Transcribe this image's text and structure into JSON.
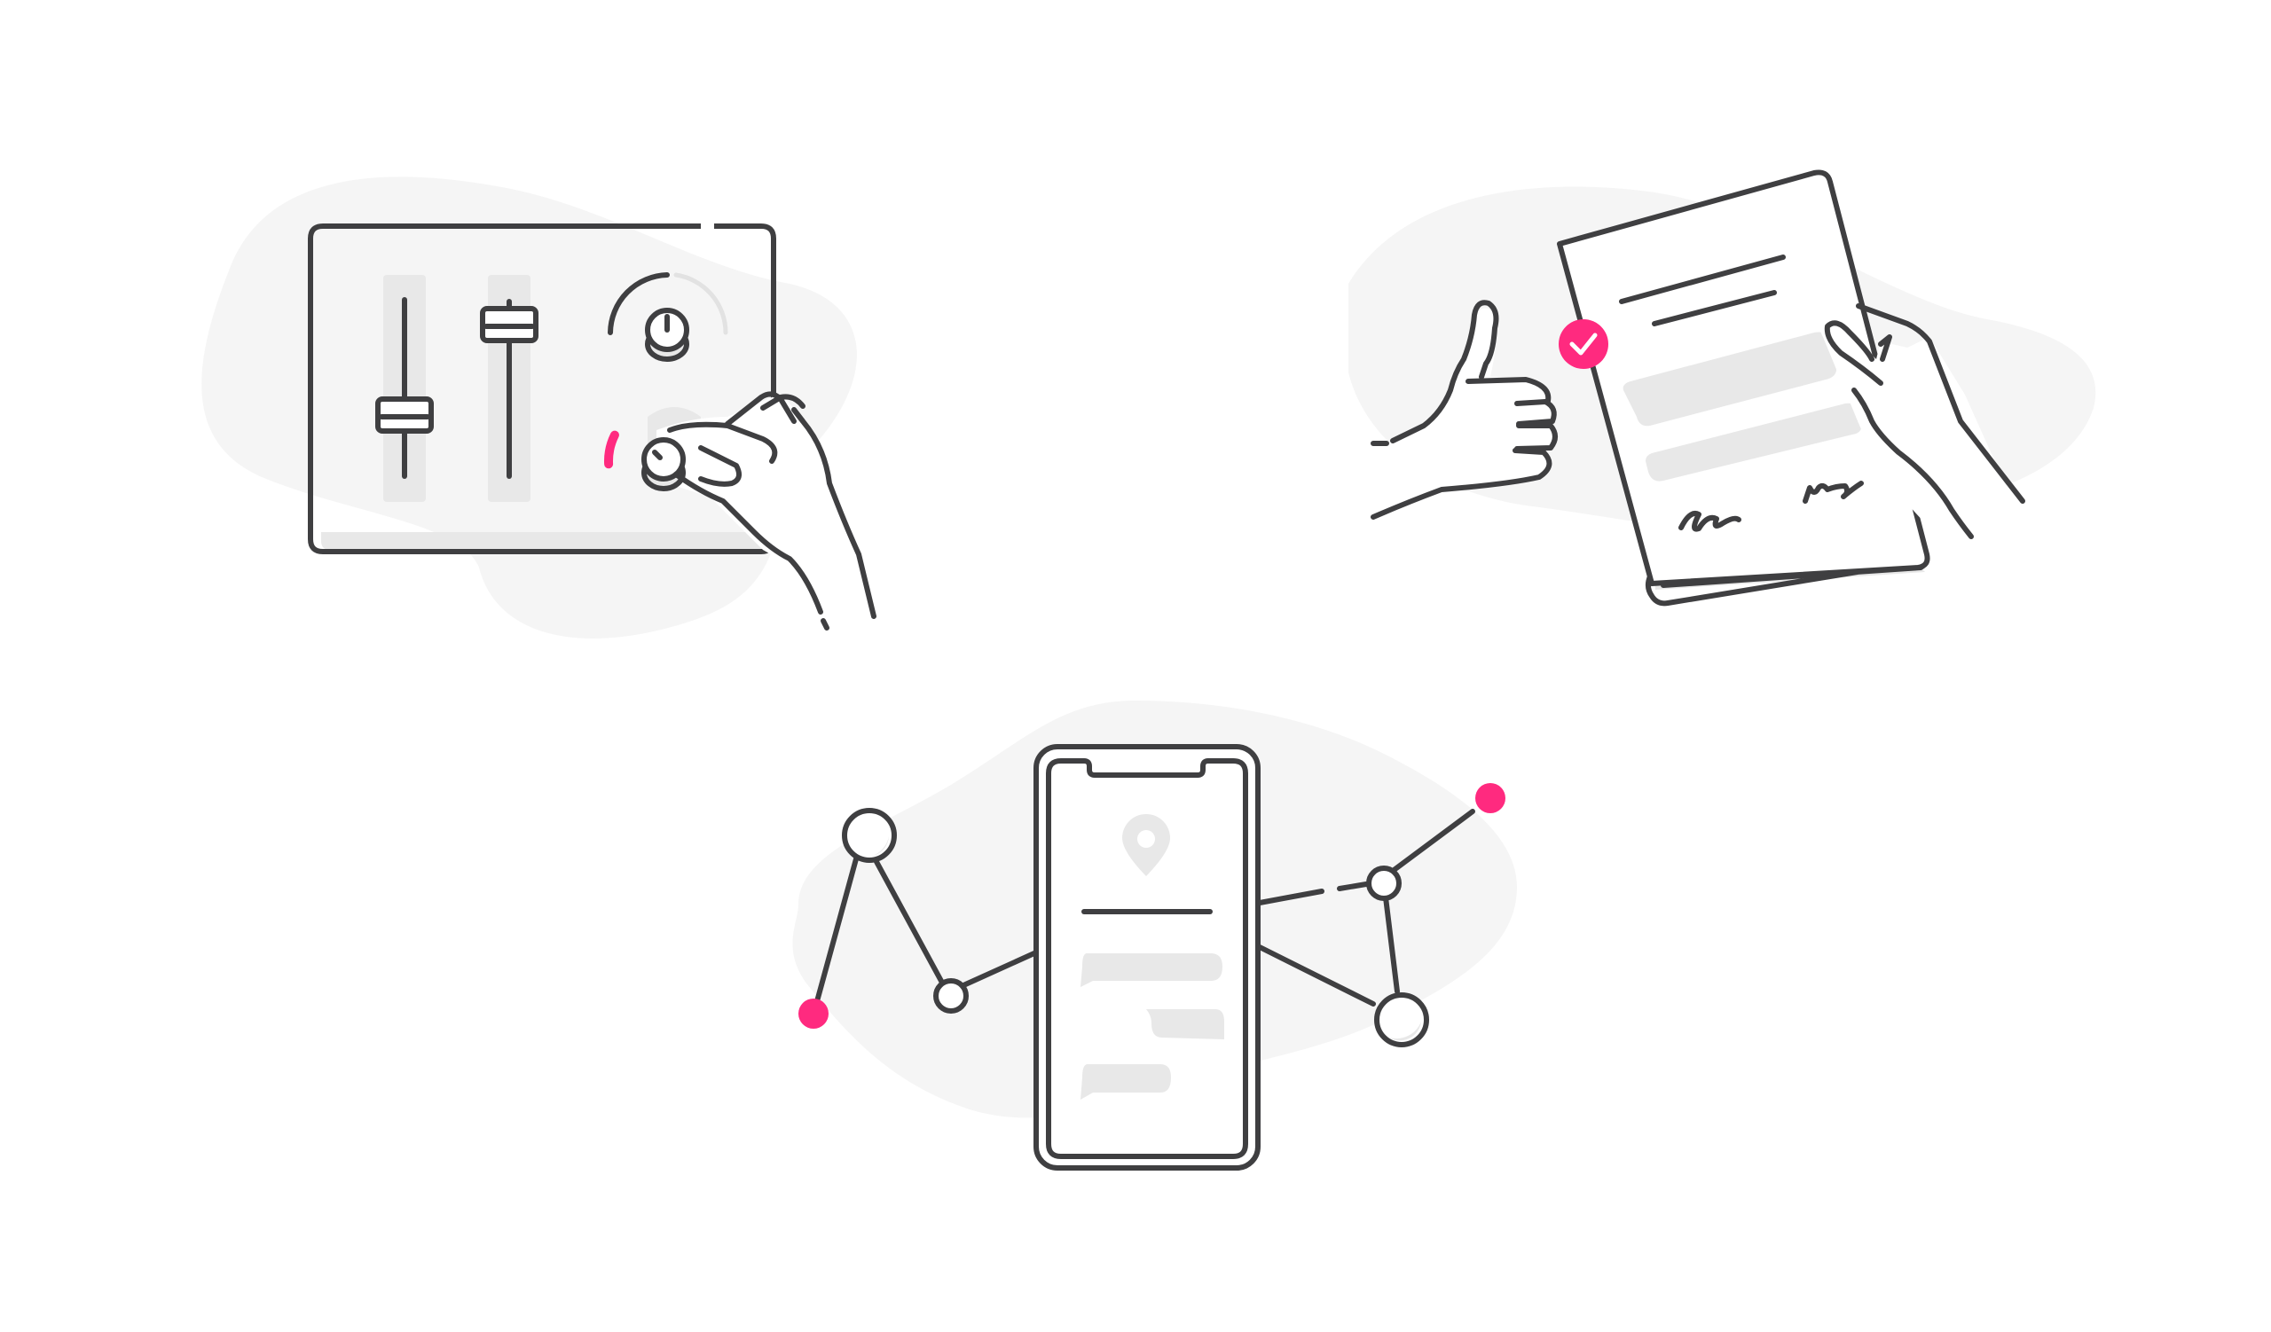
{
  "colors": {
    "ink": "#3f3f41",
    "accent": "#ff2a7f",
    "blob": "#f5f5f5",
    "soft": "#e8e8e8",
    "background": "#ffffff"
  },
  "illustrations": [
    {
      "id": "mixer-console",
      "icon": "audio-mixer-with-hand-turning-knob-icon",
      "knob_level": 0.33
    },
    {
      "id": "approved-document",
      "icon": "thumbs-up-and-signed-document-icon",
      "status_icon": "check-icon"
    },
    {
      "id": "phone-network",
      "icon": "smartphone-with-connected-nodes-icon",
      "map_icon": "location-pin-icon"
    }
  ]
}
